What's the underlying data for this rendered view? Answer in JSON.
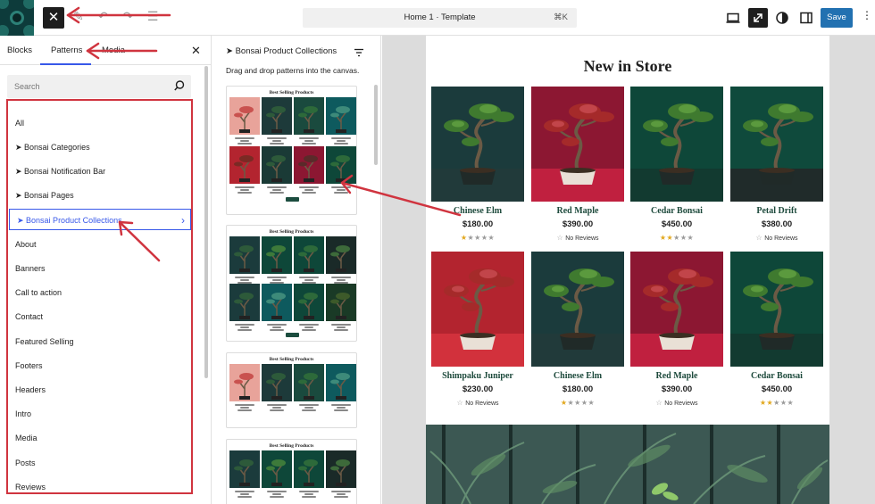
{
  "topbar": {
    "close_label": "✕",
    "faint_tools": "✎ ↶ ↷ ☰",
    "document_title": "Home 1 · Template",
    "document_shortcut": "⌘K",
    "save_label": "Save",
    "more_label": "⋮",
    "icons": [
      "site-logo",
      "close-icon",
      "desktop-preview-icon",
      "resize-icon",
      "style-contrast-icon",
      "sidebar-toggle-icon",
      "more-options-icon"
    ]
  },
  "inserter": {
    "tabs": [
      "Blocks",
      "Patterns",
      "Media"
    ],
    "active_tab": "Patterns",
    "close_label": "✕",
    "search_placeholder": "Search",
    "categories": [
      "All",
      "➤ Bonsai Categories",
      "➤ Bonsai Notification Bar",
      "➤ Bonsai Pages",
      "➤ Bonsai Product Collections",
      "About",
      "Banners",
      "Call to action",
      "Contact",
      "Featured Selling",
      "Footers",
      "Headers",
      "Intro",
      "Media",
      "Posts",
      "Reviews"
    ],
    "active_category": "➤ Bonsai Product Collections"
  },
  "patterns_panel": {
    "heading": "➤ Bonsai Product Collections",
    "description": "Drag and drop patterns into the canvas.",
    "cards": [
      {
        "title": "Best Selling Products"
      },
      {
        "title": "Best Selling Products"
      },
      {
        "title": "Best Selling Products"
      },
      {
        "title": "Best Selling Products"
      }
    ]
  },
  "canvas": {
    "heading": "New in Store",
    "products": [
      {
        "name": "Chinese Elm",
        "price": "$180.00",
        "rating": 1,
        "reviews_text": "",
        "bg": "#1b3b3c",
        "floor": "#213a3a"
      },
      {
        "name": "Red Maple",
        "price": "$390.00",
        "rating": 0,
        "reviews_text": "No Reviews",
        "bg": "#8c1732",
        "floor": "#c0203f"
      },
      {
        "name": "Cedar Bonsai",
        "price": "$450.00",
        "rating": 2,
        "reviews_text": "",
        "bg": "#0e4739",
        "floor": "#123a30"
      },
      {
        "name": "Petal Drift",
        "price": "$380.00",
        "rating": 0,
        "reviews_text": "No Reviews",
        "bg": "#0f4a3c",
        "floor": "#202b2a"
      },
      {
        "name": "Shimpaku Juniper",
        "price": "$230.00",
        "rating": 0,
        "reviews_text": "No Reviews",
        "bg": "#b3242f",
        "floor": "#d2313c"
      },
      {
        "name": "Chinese Elm",
        "price": "$180.00",
        "rating": 1,
        "reviews_text": "",
        "bg": "#1b3b3c",
        "floor": "#213a3a"
      },
      {
        "name": "Red Maple",
        "price": "$390.00",
        "rating": 0,
        "reviews_text": "No Reviews",
        "bg": "#8c1732",
        "floor": "#c0203f"
      },
      {
        "name": "Cedar Bonsai",
        "price": "$450.00",
        "rating": 2,
        "reviews_text": "",
        "bg": "#0e4739",
        "floor": "#123a30"
      }
    ]
  },
  "colors": {
    "accent": "#3858e9",
    "save": "#2271b1",
    "annotation": "#d0343f",
    "product_name": "#1d4a3c"
  }
}
